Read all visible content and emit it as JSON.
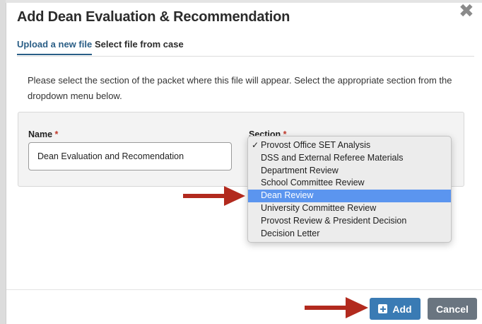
{
  "modal": {
    "title": "Add Dean Evaluation & Recommendation",
    "close_glyph": "✖"
  },
  "tabs": [
    {
      "label": "Upload a new file",
      "active": true
    },
    {
      "label": "Select file from case",
      "active": false
    }
  ],
  "instructions": "Please select the section of the packet where this file will appear. Select the appropriate section from the dropdown menu below.",
  "form": {
    "name_label": "Name",
    "section_label": "Section",
    "required_marker": "*",
    "name_value": "Dean Evaluation and Recomendation"
  },
  "dropdown": {
    "check_glyph": "✓",
    "options": [
      "Provost Office SET Analysis",
      "DSS and External Referee Materials",
      "Department Review",
      "School Committee Review",
      "Dean Review",
      "University Committee Review",
      "Provost Review & President Decision",
      "Decision Letter"
    ],
    "checked_option": "Provost Office SET Analysis",
    "highlighted_option": "Dean Review"
  },
  "footer": {
    "add_label": "Add",
    "cancel_label": "Cancel"
  },
  "colors": {
    "accent": "#3a7bb4",
    "tab_active": "#2a5e86",
    "highlight": "#5b95ef",
    "annotation_arrow": "#b22a1e",
    "cancel": "#6a7580"
  },
  "icons": {
    "close": "close-icon",
    "check": "checkmark-icon",
    "add": "plus-square-icon",
    "annotation": "arrow-right-icon"
  }
}
